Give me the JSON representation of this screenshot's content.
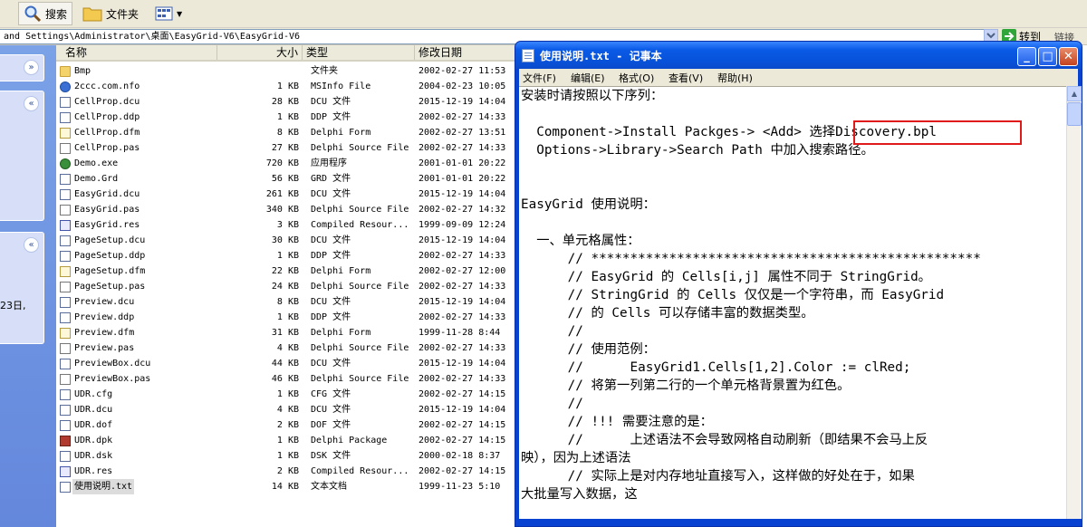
{
  "toolbar": {
    "search_label": "搜索",
    "folders_label": "文件夹"
  },
  "address": {
    "path": "and Settings\\Administrator\\桌面\\EasyGrid-V6\\EasyGrid-V6",
    "go_label": "转到",
    "links_label": "链接"
  },
  "left_pane": {
    "text": "23日,"
  },
  "columns": {
    "name": "名称",
    "size": "大小",
    "type": "类型",
    "modified": "修改日期"
  },
  "files": [
    {
      "name": "Bmp",
      "size": "",
      "type": "文件夹",
      "date": "2002-02-27 11:53",
      "icon": "folder-icon"
    },
    {
      "name": "2ccc.com.nfo",
      "size": "1 KB",
      "type": "MSInfo File",
      "date": "2004-02-23 10:05",
      "icon": "info-file-icon"
    },
    {
      "name": "CellProp.dcu",
      "size": "28 KB",
      "type": "DCU 文件",
      "date": "2015-12-19 14:04",
      "icon": "file-icon"
    },
    {
      "name": "CellProp.ddp",
      "size": "1 KB",
      "type": "DDP 文件",
      "date": "2002-02-27 14:33",
      "icon": "file-icon"
    },
    {
      "name": "CellProp.dfm",
      "size": "8 KB",
      "type": "Delphi Form",
      "date": "2002-02-27 13:51",
      "icon": "delphi-form-icon"
    },
    {
      "name": "CellProp.pas",
      "size": "27 KB",
      "type": "Delphi Source File",
      "date": "2002-02-27 14:33",
      "icon": "delphi-source-icon"
    },
    {
      "name": "Demo.exe",
      "size": "720 KB",
      "type": "应用程序",
      "date": "2001-01-01 20:22",
      "icon": "exe-icon"
    },
    {
      "name": "Demo.Grd",
      "size": "56 KB",
      "type": "GRD 文件",
      "date": "2001-01-01 20:22",
      "icon": "file-icon"
    },
    {
      "name": "EasyGrid.dcu",
      "size": "261 KB",
      "type": "DCU 文件",
      "date": "2015-12-19 14:04",
      "icon": "file-icon"
    },
    {
      "name": "EasyGrid.pas",
      "size": "340 KB",
      "type": "Delphi Source File",
      "date": "2002-02-27 14:32",
      "icon": "delphi-source-icon"
    },
    {
      "name": "EasyGrid.res",
      "size": "3 KB",
      "type": "Compiled Resour...",
      "date": "1999-09-09 12:24",
      "icon": "resource-file-icon"
    },
    {
      "name": "PageSetup.dcu",
      "size": "30 KB",
      "type": "DCU 文件",
      "date": "2015-12-19 14:04",
      "icon": "file-icon"
    },
    {
      "name": "PageSetup.ddp",
      "size": "1 KB",
      "type": "DDP 文件",
      "date": "2002-02-27 14:33",
      "icon": "file-icon"
    },
    {
      "name": "PageSetup.dfm",
      "size": "22 KB",
      "type": "Delphi Form",
      "date": "2002-02-27 12:00",
      "icon": "delphi-form-icon"
    },
    {
      "name": "PageSetup.pas",
      "size": "24 KB",
      "type": "Delphi Source File",
      "date": "2002-02-27 14:33",
      "icon": "delphi-source-icon"
    },
    {
      "name": "Preview.dcu",
      "size": "8 KB",
      "type": "DCU 文件",
      "date": "2015-12-19 14:04",
      "icon": "file-icon"
    },
    {
      "name": "Preview.ddp",
      "size": "1 KB",
      "type": "DDP 文件",
      "date": "2002-02-27 14:33",
      "icon": "file-icon"
    },
    {
      "name": "Preview.dfm",
      "size": "31 KB",
      "type": "Delphi Form",
      "date": "1999-11-28 8:44",
      "icon": "delphi-form-icon"
    },
    {
      "name": "Preview.pas",
      "size": "4 KB",
      "type": "Delphi Source File",
      "date": "2002-02-27 14:33",
      "icon": "delphi-source-icon"
    },
    {
      "name": "PreviewBox.dcu",
      "size": "44 KB",
      "type": "DCU 文件",
      "date": "2015-12-19 14:04",
      "icon": "file-icon"
    },
    {
      "name": "PreviewBox.pas",
      "size": "46 KB",
      "type": "Delphi Source File",
      "date": "2002-02-27 14:33",
      "icon": "delphi-source-icon"
    },
    {
      "name": "UDR.cfg",
      "size": "1 KB",
      "type": "CFG 文件",
      "date": "2002-02-27 14:15",
      "icon": "file-icon"
    },
    {
      "name": "UDR.dcu",
      "size": "4 KB",
      "type": "DCU 文件",
      "date": "2015-12-19 14:04",
      "icon": "file-icon"
    },
    {
      "name": "UDR.dof",
      "size": "2 KB",
      "type": "DOF 文件",
      "date": "2002-02-27 14:15",
      "icon": "file-icon"
    },
    {
      "name": "UDR.dpk",
      "size": "1 KB",
      "type": "Delphi Package",
      "date": "2002-02-27 14:15",
      "icon": "delphi-package-icon"
    },
    {
      "name": "UDR.dsk",
      "size": "1 KB",
      "type": "DSK 文件",
      "date": "2000-02-18 8:37",
      "icon": "file-icon"
    },
    {
      "name": "UDR.res",
      "size": "2 KB",
      "type": "Compiled Resour...",
      "date": "2002-02-27 14:15",
      "icon": "resource-file-icon"
    },
    {
      "name": "使用说明.txt",
      "size": "14 KB",
      "type": "文本文档",
      "date": "1999-11-23 5:10",
      "icon": "text-file-icon",
      "selected": true
    }
  ],
  "notepad": {
    "title": "使用说明.txt - 记事本",
    "menu": [
      "文件(F)",
      "编辑(E)",
      "格式(O)",
      "查看(V)",
      "帮助(H)"
    ],
    "lines": [
      "安装时请按照以下序列：",
      "",
      "  Component->Install Packges-> <Add> 选择Discovery.bpl",
      "  Options->Library->Search Path 中加入搜索路径。",
      "",
      "",
      "EasyGrid 使用说明：",
      "",
      "  一、单元格属性：",
      "      // **************************************************",
      "      // EasyGrid 的 Cells[i,j] 属性不同于 StringGrid。",
      "      // StringGrid 的 Cells 仅仅是一个字符串，而 EasyGrid",
      "      // 的 Cells 可以存储丰富的数据类型。",
      "      //",
      "      // 使用范例：",
      "      //      EasyGrid1.Cells[1,2].Color := clRed;",
      "      // 将第一列第二行的一个单元格背景置为红色。",
      "      //",
      "      // !!! 需要注意的是：",
      "      //      上述语法不会导致网格自动刷新（即结果不会马上反",
      "映），因为上述语法",
      "      // 实际上是对内存地址直接写入，这样做的好处在于，如果",
      "大批量写入数据，这"
    ]
  }
}
